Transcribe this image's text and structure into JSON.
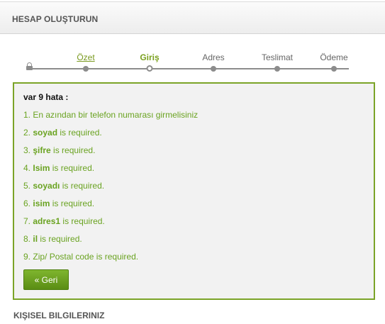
{
  "header": {
    "title": "HESAP OLUŞTURUN"
  },
  "progress": {
    "steps": [
      {
        "label": "Özet",
        "state": "link"
      },
      {
        "label": "Giriş",
        "state": "current"
      },
      {
        "label": "Adres",
        "state": "upcoming"
      },
      {
        "label": "Teslimat",
        "state": "upcoming"
      },
      {
        "label": "Ödeme",
        "state": "upcoming"
      }
    ]
  },
  "errors": {
    "title": "var 9 hata :",
    "items": [
      {
        "num": "1.",
        "field": "",
        "text": "En azından bir telefon numarası girmelisiniz"
      },
      {
        "num": "2.",
        "field": "soyad",
        "text": " is required."
      },
      {
        "num": "3.",
        "field": "şifre",
        "text": " is required."
      },
      {
        "num": "4.",
        "field": "Isim",
        "text": " is required."
      },
      {
        "num": "5.",
        "field": "soyadı",
        "text": " is required."
      },
      {
        "num": "6.",
        "field": "isim",
        "text": " is required."
      },
      {
        "num": "7.",
        "field": "adres1",
        "text": " is required."
      },
      {
        "num": "8.",
        "field": "il",
        "text": " is required."
      },
      {
        "num": "9.",
        "field": "",
        "text": "Zip/ Postal code is required."
      }
    ],
    "back_label": "« Geri"
  },
  "section": {
    "title": "KIŞISEL BILGILERINIZ"
  },
  "colors": {
    "accent_green": "#7ba428",
    "error_text": "#6aa321",
    "button_green": "#6aa021"
  }
}
